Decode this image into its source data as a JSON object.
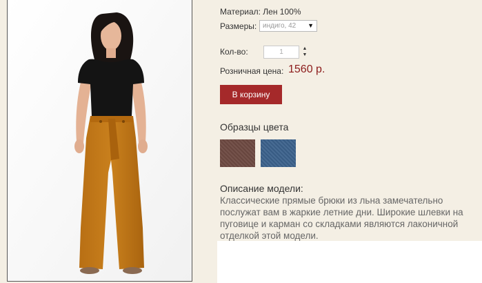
{
  "product": {
    "material": "Материал: Лен 100%",
    "sizes_label": "Размеры:",
    "size_selected": "индиго, 42",
    "quantity_label": "Кол-во:",
    "quantity_value": "1",
    "price_label": "Розничная цена:",
    "price_value": "1560 р.",
    "cart_button_label": "В корзину"
  },
  "swatches": {
    "title": "Образцы цвета",
    "colors": [
      "#6e4a42",
      "#3c628c"
    ]
  },
  "description": {
    "title": "Описание модели:",
    "text": "Классические прямые брюки из льна замечательно послужат вам в жаркие летние дни. Широкие шлевки на пуговице и карман со складками являются лаконичной отделкой этой модели."
  },
  "colors": {
    "page_background": "#f4efe4",
    "accent_button": "#a5292a",
    "price": "#8b1a1a"
  }
}
